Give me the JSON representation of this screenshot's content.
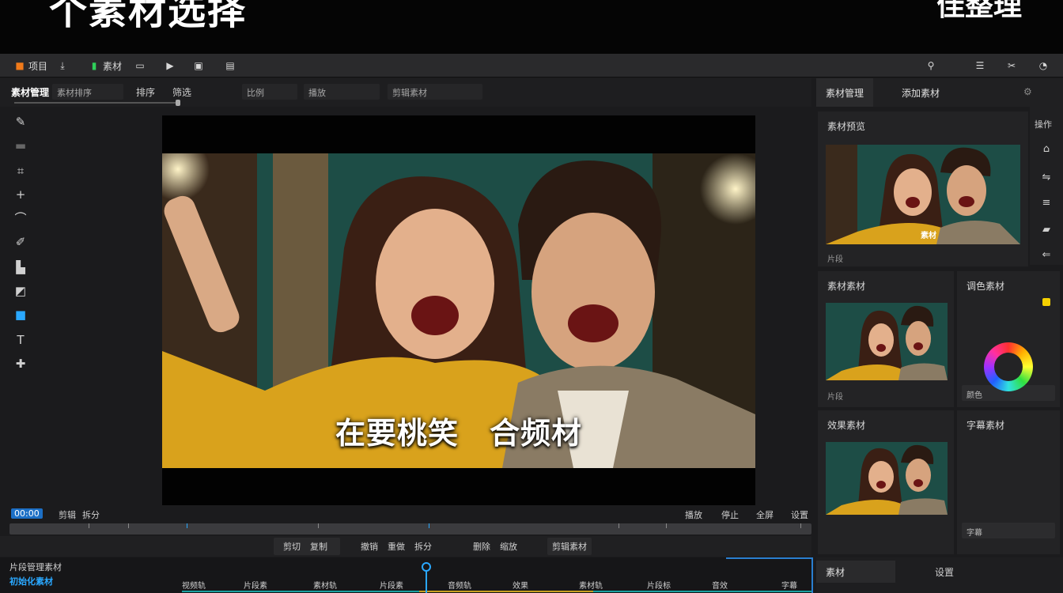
{
  "banner": {
    "title": "个素材选择",
    "right": "佳整理"
  },
  "topbar": {
    "items": [
      "项目",
      "导入",
      "素材",
      "预览",
      "特效",
      "滤镜",
      "导出"
    ],
    "right_icons": [
      "share-icon",
      "menu-icon",
      "trim-icon",
      "help-icon"
    ]
  },
  "subbar": {
    "title": "素材管理",
    "fields": [
      "素材排序",
      "排序",
      "筛选",
      "比例",
      "播放",
      "剪辑素材"
    ]
  },
  "viewer": {
    "subtitle": "在要桃笑　合频材"
  },
  "transport": {
    "left": [
      "00:00",
      "剪辑",
      "拆分"
    ],
    "right": [
      "播放",
      "停止",
      "全屏",
      "设置"
    ]
  },
  "ctrl": {
    "buttons": [
      "剪切",
      "复制",
      "撤销",
      "重做",
      "拆分",
      "删除",
      "缩放",
      "剪辑素材"
    ]
  },
  "timeline": {
    "title": "片段管理素材",
    "sub": "初始化素材",
    "clips": [
      "视频轨",
      "片段素",
      "素材轨",
      "片段素",
      "音频轨",
      "效果",
      "素材轨",
      "片段标",
      "音效",
      "字幕"
    ]
  },
  "right_panel": {
    "tabs": [
      "素材管理",
      "添加素材"
    ],
    "sections": [
      {
        "title": "素材预览",
        "foot": "片段",
        "thumb_caption": "素材"
      },
      {
        "title": "素材素材",
        "foot": "片段"
      },
      {
        "title": "调色素材",
        "field": "颜色"
      },
      {
        "title": "效果素材"
      },
      {
        "title": "字幕素材",
        "field": "字幕"
      }
    ],
    "side_label": "操作",
    "bottom_tabs": [
      "素材",
      "设置"
    ]
  },
  "colors": {
    "accent": "#2aa8ff",
    "orange": "#f07a1a",
    "green": "#2fcf5a"
  }
}
